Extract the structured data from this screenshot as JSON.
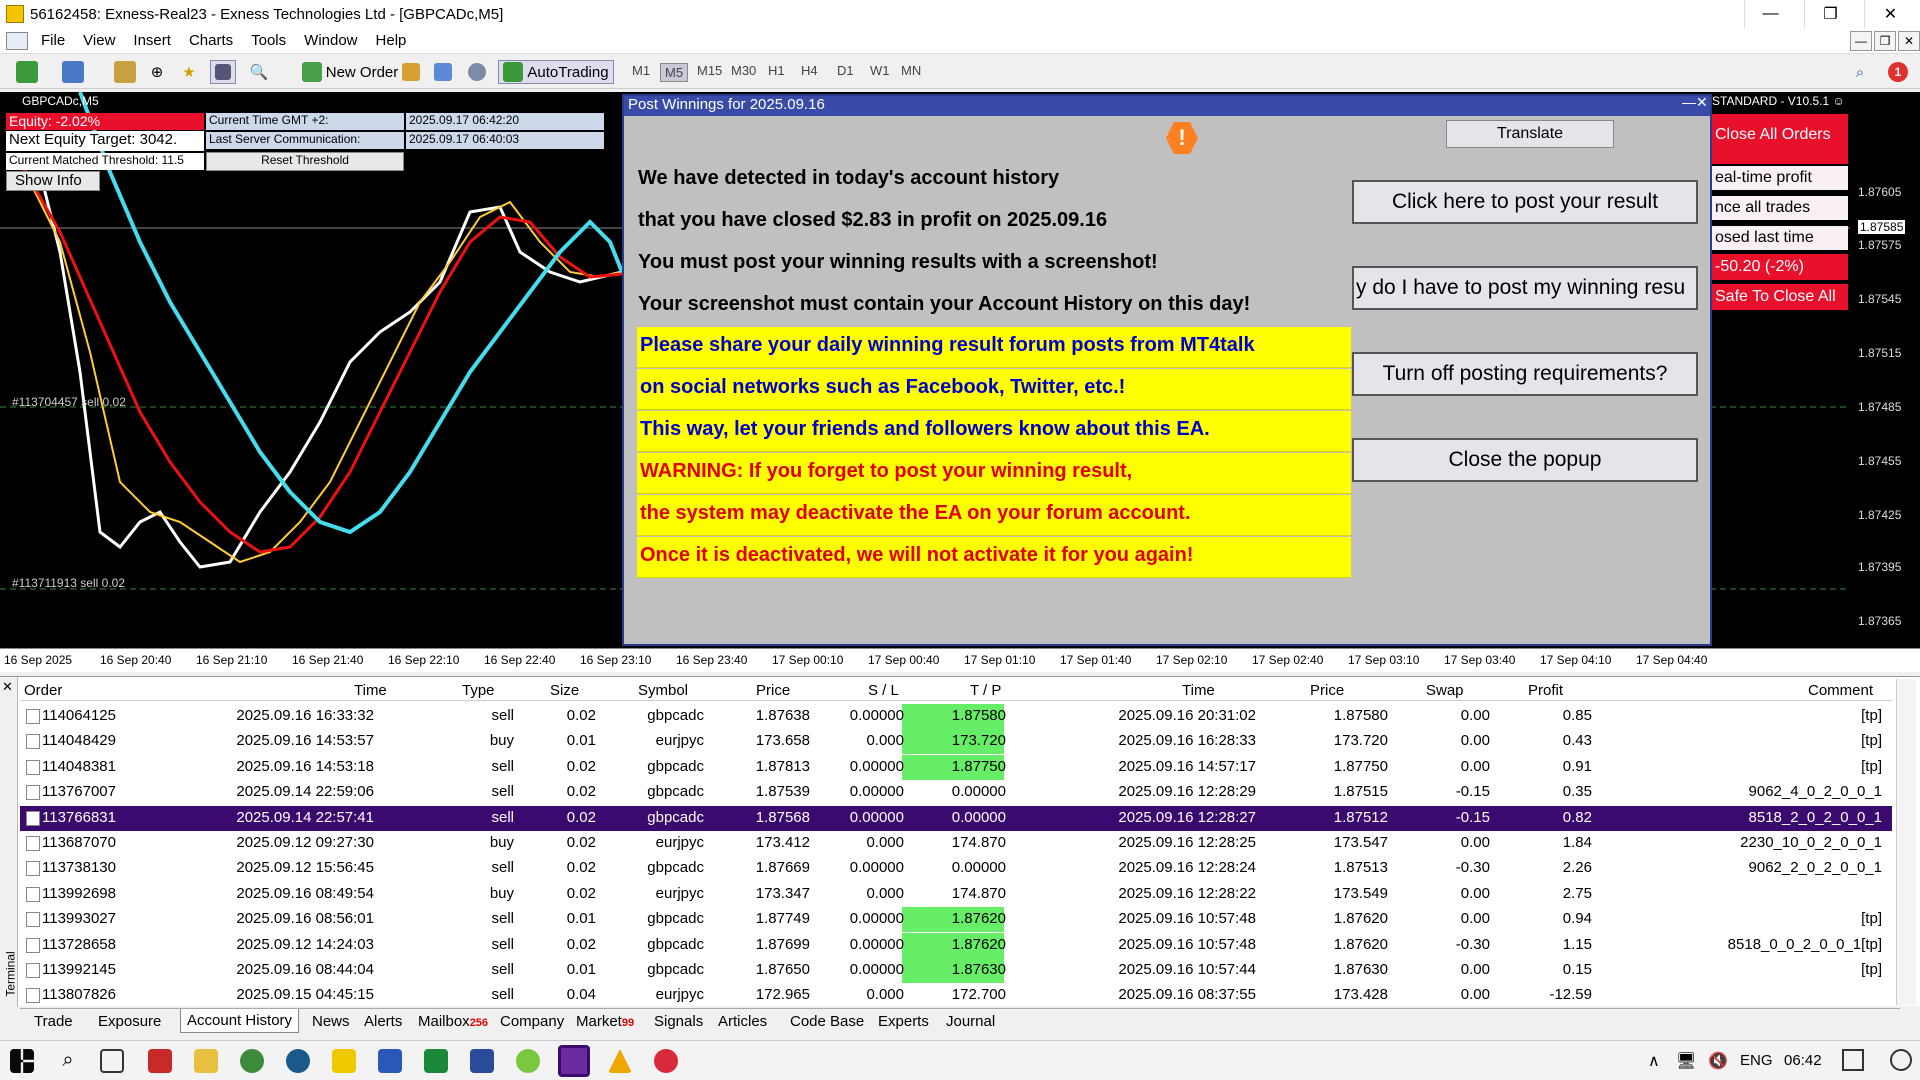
{
  "window": {
    "title": "56162458: Exness-Real23 - Exness Technologies Ltd - [GBPCADc,M5]"
  },
  "menu": [
    "File",
    "View",
    "Insert",
    "Charts",
    "Tools",
    "Window",
    "Help"
  ],
  "toolbar": {
    "new_order": "New Order",
    "autotrading": "AutoTrading",
    "timeframes": [
      "M1",
      "M5",
      "M15",
      "M30",
      "H1",
      "H4",
      "D1",
      "W1",
      "MN"
    ],
    "active_timeframe": "M5"
  },
  "chart": {
    "symbol_label": "GBPCADc,M5",
    "price_labels": [
      "1.87605",
      "1.87575",
      "1.87545",
      "1.87515",
      "1.87485",
      "1.87455",
      "1.87425",
      "1.87395",
      "1.87365"
    ],
    "current_price": "1.87585",
    "time_labels": [
      "16 Sep 2025",
      "16 Sep 20:40",
      "16 Sep 21:10",
      "16 Sep 21:40",
      "16 Sep 22:10",
      "16 Sep 22:40",
      "16 Sep 23:10",
      "16 Sep 23:40",
      "17 Sep 00:10",
      "17 Sep 00:40",
      "17 Sep 01:10",
      "17 Sep 01:40",
      "17 Sep 02:10",
      "17 Sep 02:40",
      "17 Sep 03:10",
      "17 Sep 03:40",
      "17 Sep 04:10",
      "17 Sep 04:40"
    ],
    "order_line_1": "#113704457 sell 0.02",
    "order_line_2": "#113711913 sell 0.02"
  },
  "info_panel": {
    "equity": "Equity: -2.02%",
    "next_equity_target": "Next Equity Target: 3042.",
    "threshold": "Current Matched Threshold: 11.5",
    "show_info": "Show Info",
    "current_time_label": "Current Time GMT +2:",
    "current_time_value": "2025.09.17 06:42:20",
    "last_server_label": "Last Server Communication:",
    "last_server_value": "2025.09.17 06:40:03",
    "reset_threshold": "Reset Threshold"
  },
  "ea_panel": {
    "header": "STANDARD - V10.5.1",
    "close_all_orders": "Close All Orders",
    "realtime_profit": "eal-time profit",
    "balance_trades": "nce all trades",
    "closed_last_time": "osed last time",
    "loss_value": "-50.20 (-2%)",
    "safe_close": "Safe To Close All"
  },
  "popup": {
    "title": "Post Winnings for 2025.09.16",
    "translate": "Translate",
    "lines": [
      "We have detected in today's account history",
      "that you have closed $2.83 in profit on 2025.09.16",
      "You must post your winning results with a screenshot!",
      "Your screenshot must contain your Account History on this day!"
    ],
    "yellow_lines": [
      {
        "text": "Please share your daily winning result forum posts from MT4talk",
        "color": "#0000cc"
      },
      {
        "text": "on social networks such as Facebook, Twitter, etc.!",
        "color": "#0000cc"
      },
      {
        "text": "This way, let your friends and followers know about this EA.",
        "color": "#0000cc"
      },
      {
        "text": "WARNING: If you forget to post your winning result,",
        "color": "#e00000"
      },
      {
        "text": "the system may deactivate the EA on your forum account.",
        "color": "#e00000"
      },
      {
        "text": "Once it is deactivated, we will not activate it for you again!",
        "color": "#e00000"
      }
    ],
    "btn_post": "Click here to post your result",
    "btn_why": "y do I have to post my winning resu",
    "btn_turnoff": "Turn off posting requirements?",
    "btn_close": "Close the popup"
  },
  "terminal": {
    "side_label": "Terminal",
    "headers": [
      "Order",
      "Time",
      "Type",
      "Size",
      "Symbol",
      "Price",
      "S / L",
      "T / P",
      "Time",
      "Price",
      "Swap",
      "Profit",
      "Comment"
    ],
    "rows": [
      {
        "order": "114064125",
        "time": "2025.09.16 16:33:32",
        "type": "sell",
        "size": "0.02",
        "symbol": "gbpcadc",
        "price": "1.87638",
        "sl": "0.00000",
        "tp": "1.87580",
        "ctime": "2025.09.16 20:31:02",
        "cprice": "1.87580",
        "swap": "0.00",
        "profit": "0.85",
        "comment": "[tp]",
        "tp_hit": true
      },
      {
        "order": "114048429",
        "time": "2025.09.16 14:53:57",
        "type": "buy",
        "size": "0.01",
        "symbol": "eurjpyc",
        "price": "173.658",
        "sl": "0.000",
        "tp": "173.720",
        "ctime": "2025.09.16 16:28:33",
        "cprice": "173.720",
        "swap": "0.00",
        "profit": "0.43",
        "comment": "[tp]",
        "tp_hit": true
      },
      {
        "order": "114048381",
        "time": "2025.09.16 14:53:18",
        "type": "sell",
        "size": "0.02",
        "symbol": "gbpcadc",
        "price": "1.87813",
        "sl": "0.00000",
        "tp": "1.87750",
        "ctime": "2025.09.16 14:57:17",
        "cprice": "1.87750",
        "swap": "0.00",
        "profit": "0.91",
        "comment": "[tp]",
        "tp_hit": true
      },
      {
        "order": "113767007",
        "time": "2025.09.14 22:59:06",
        "type": "sell",
        "size": "0.02",
        "symbol": "gbpcadc",
        "price": "1.87539",
        "sl": "0.00000",
        "tp": "0.00000",
        "ctime": "2025.09.16 12:28:29",
        "cprice": "1.87515",
        "swap": "-0.15",
        "profit": "0.35",
        "comment": "9062_4_0_2_0_0_1",
        "tp_hit": false
      },
      {
        "order": "113766831",
        "time": "2025.09.14 22:57:41",
        "type": "sell",
        "size": "0.02",
        "symbol": "gbpcadc",
        "price": "1.87568",
        "sl": "0.00000",
        "tp": "0.00000",
        "ctime": "2025.09.16 12:28:27",
        "cprice": "1.87512",
        "swap": "-0.15",
        "profit": "0.82",
        "comment": "8518_2_0_2_0_0_1",
        "tp_hit": false,
        "selected": true
      },
      {
        "order": "113687070",
        "time": "2025.09.12 09:27:30",
        "type": "buy",
        "size": "0.02",
        "symbol": "eurjpyc",
        "price": "173.412",
        "sl": "0.000",
        "tp": "174.870",
        "ctime": "2025.09.16 12:28:25",
        "cprice": "173.547",
        "swap": "0.00",
        "profit": "1.84",
        "comment": "2230_10_0_2_0_0_1",
        "tp_hit": false
      },
      {
        "order": "113738130",
        "time": "2025.09.12 15:56:45",
        "type": "sell",
        "size": "0.02",
        "symbol": "gbpcadc",
        "price": "1.87669",
        "sl": "0.00000",
        "tp": "0.00000",
        "ctime": "2025.09.16 12:28:24",
        "cprice": "1.87513",
        "swap": "-0.30",
        "profit": "2.26",
        "comment": "9062_2_0_2_0_0_1",
        "tp_hit": false
      },
      {
        "order": "113992698",
        "time": "2025.09.16 08:49:54",
        "type": "buy",
        "size": "0.02",
        "symbol": "eurjpyc",
        "price": "173.347",
        "sl": "0.000",
        "tp": "174.870",
        "ctime": "2025.09.16 12:28:22",
        "cprice": "173.549",
        "swap": "0.00",
        "profit": "2.75",
        "comment": "",
        "tp_hit": false
      },
      {
        "order": "113993027",
        "time": "2025.09.16 08:56:01",
        "type": "sell",
        "size": "0.01",
        "symbol": "gbpcadc",
        "price": "1.87749",
        "sl": "0.00000",
        "tp": "1.87620",
        "ctime": "2025.09.16 10:57:48",
        "cprice": "1.87620",
        "swap": "0.00",
        "profit": "0.94",
        "comment": "[tp]",
        "tp_hit": true
      },
      {
        "order": "113728658",
        "time": "2025.09.12 14:24:03",
        "type": "sell",
        "size": "0.02",
        "symbol": "gbpcadc",
        "price": "1.87699",
        "sl": "0.00000",
        "tp": "1.87620",
        "ctime": "2025.09.16 10:57:48",
        "cprice": "1.87620",
        "swap": "-0.30",
        "profit": "1.15",
        "comment": "8518_0_0_2_0_0_1[tp]",
        "tp_hit": true
      },
      {
        "order": "113992145",
        "time": "2025.09.16 08:44:04",
        "type": "sell",
        "size": "0.01",
        "symbol": "gbpcadc",
        "price": "1.87650",
        "sl": "0.00000",
        "tp": "1.87630",
        "ctime": "2025.09.16 10:57:44",
        "cprice": "1.87630",
        "swap": "0.00",
        "profit": "0.15",
        "comment": "[tp]",
        "tp_hit": true
      },
      {
        "order": "113807826",
        "time": "2025.09.15 04:45:15",
        "type": "sell",
        "size": "0.04",
        "symbol": "eurjpyc",
        "price": "172.965",
        "sl": "0.000",
        "tp": "172.700",
        "ctime": "2025.09.16 08:37:55",
        "cprice": "173.428",
        "swap": "0.00",
        "profit": "-12.59",
        "comment": "",
        "tp_hit": false
      }
    ],
    "tabs": [
      {
        "label": "Trade"
      },
      {
        "label": "Exposure"
      },
      {
        "label": "Account History",
        "active": true
      },
      {
        "label": "News"
      },
      {
        "label": "Alerts"
      },
      {
        "label": "Mailbox",
        "badge": "256"
      },
      {
        "label": "Company"
      },
      {
        "label": "Market",
        "badge": "99"
      },
      {
        "label": "Signals"
      },
      {
        "label": "Articles"
      },
      {
        "label": "Code Base"
      },
      {
        "label": "Experts"
      },
      {
        "label": "Journal"
      }
    ]
  },
  "taskbar": {
    "language": "ENG",
    "clock": "06:42"
  },
  "colors": {
    "popup_title_bg": "#3a4aa8",
    "yellow": "#ffff00",
    "tp_green": "#66ee66",
    "selected_row": "#3b0a6e",
    "ea_red": "#e8102a"
  }
}
